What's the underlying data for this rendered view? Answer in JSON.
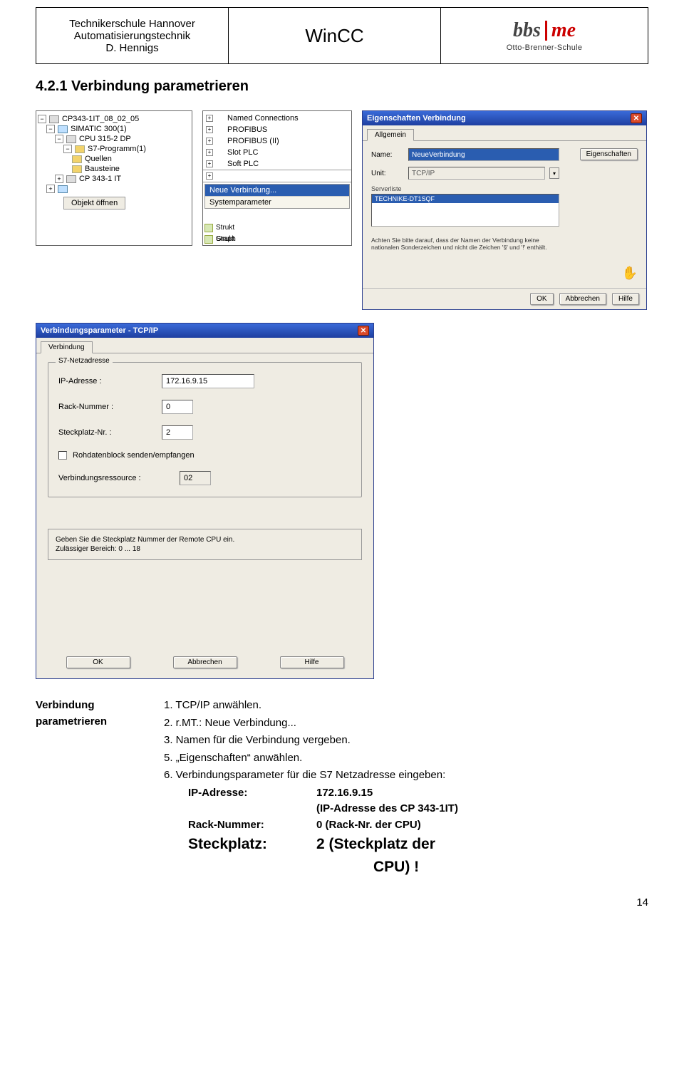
{
  "header": {
    "left_line1": "Technikerschule Hannover",
    "left_line2": "Automatisierungstechnik",
    "left_line3": "D. Hennigs",
    "mid_title": "WinCC",
    "logo_bbs": "bbs",
    "logo_me": "me",
    "logo_sub": "Otto-Brenner-Schule"
  },
  "section_heading": "4.2.1 Verbindung parametrieren",
  "tree": {
    "root": "CP343-1IT_08_02_05",
    "n1": "SIMATIC 300(1)",
    "n2": "CPU 315-2 DP",
    "n3": "S7-Programm(1)",
    "n4a": "Quellen",
    "n4b": "Bausteine",
    "n5": "CP 343-1 IT",
    "btn": "Objekt öffnen"
  },
  "ctx": {
    "items": [
      "Named Connections",
      "PROFIBUS",
      "PROFIBUS (II)",
      "Slot PLC",
      "Soft PLC"
    ],
    "hi": "Neue Verbindung...",
    "sub": "Systemparameter",
    "foot1": "Strukt",
    "foot2": "Graph"
  },
  "props": {
    "title": "Eigenschaften Verbindung",
    "tab": "Allgemein",
    "name_lbl": "Name:",
    "name_val": "NeueVerbindung",
    "unit_lbl": "Unit:",
    "unit_val": "TCP/IP",
    "eig_btn": "Eigenschaften",
    "srv_lbl": "Serverliste",
    "srv_item": "TECHNIKE-DT1SQF",
    "hint": "Achten Sie bitte darauf, dass der Namen der Verbindung keine nationalen Sonderzeichen und nicht die Zeichen '§' und '!' enthält.",
    "ok": "OK",
    "cancel": "Abbrechen",
    "help": "Hilfe"
  },
  "conn": {
    "title": "Verbindungsparameter - TCP/IP",
    "tab": "Verbindung",
    "group": "S7-Netzadresse",
    "ip_lbl": "IP-Adresse :",
    "ip_val": "172.16.9.15",
    "rack_lbl": "Rack-Nummer :",
    "rack_val": "0",
    "slot_lbl": "Steckplatz-Nr. :",
    "slot_val": "2",
    "raw_lbl": "Rohdatenblock senden/empfangen",
    "res_lbl": "Verbindungsressource :",
    "res_val": "02",
    "hint1": "Geben Sie die Steckplatz Nummer der Remote CPU ein.",
    "hint2": "Zulässiger Bereich: 0 ... 18",
    "ok": "OK",
    "cancel": "Abbrechen",
    "help": "Hilfe"
  },
  "instr": {
    "left1": "Verbindung",
    "left2": "parametrieren",
    "li1": "1. TCP/IP anwählen.",
    "li2": "2. r.MT.: Neue Verbindung...",
    "li3": "3. Namen für die Verbindung vergeben.",
    "li5": "5. „Eigenschaften“ anwählen.",
    "li6": "6. Verbindungsparameter für die S7 Netzadresse eingeben:",
    "ip_k": "IP-Adresse:",
    "ip_v": "172.16.9.15",
    "ip_note": "(IP-Adresse des CP 343-1IT)",
    "rack_k": "Rack-Nummer:",
    "rack_v": "0 (Rack-Nr. der CPU)",
    "slot_k": "Steckplatz:",
    "slot_v": "2 (Steckplatz der",
    "slot_v2": "CPU) !"
  },
  "page_number": "14"
}
